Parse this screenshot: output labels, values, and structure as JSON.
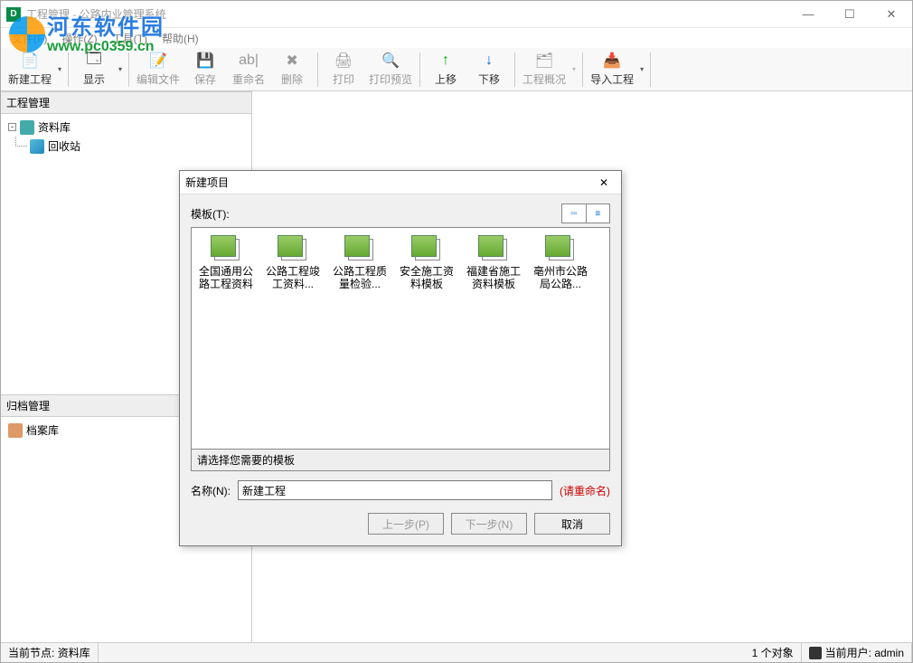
{
  "titlebar": {
    "title": "工程管理 - 公路内业管理系统"
  },
  "menubar": {
    "items": [
      "文件(F)",
      "操作(Z)",
      "工具(T)",
      "帮助(H)"
    ]
  },
  "toolbar": {
    "new_project": "新建工程",
    "display": "显示",
    "edit_file": "编辑文件",
    "save": "保存",
    "rename": "重命名",
    "delete": "删除",
    "print": "打印",
    "print_preview": "打印预览",
    "move_up": "上移",
    "move_down": "下移",
    "project_overview": "工程概况",
    "import_project": "导入工程"
  },
  "left": {
    "panel1_title": "工程管理",
    "tree_root": "资料库",
    "tree_child": "回收站",
    "panel2_title": "归档管理",
    "archive_root": "档案库"
  },
  "dialog": {
    "title": "新建项目",
    "templates_label": "模板(T):",
    "templates": [
      "全国通用公路工程资料",
      "公路工程竣工资料...",
      "公路工程质量检验...",
      "安全施工资料模板",
      "福建省施工资料模板",
      "亳州市公路局公路..."
    ],
    "hint": "请选择您需要的模板",
    "name_label": "名称(N):",
    "name_value": "新建工程",
    "rename_hint": "(请重命名)",
    "btn_prev": "上一步(P)",
    "btn_next": "下一步(N)",
    "btn_cancel": "取消"
  },
  "statusbar": {
    "current_node_label": "当前节点:",
    "current_node_value": "资料库",
    "object_count": "1 个对象",
    "current_user_label": "当前用户:",
    "current_user_value": "admin"
  },
  "watermark": {
    "line1": "河东软件园",
    "line2": "www.pc0359.cn"
  }
}
